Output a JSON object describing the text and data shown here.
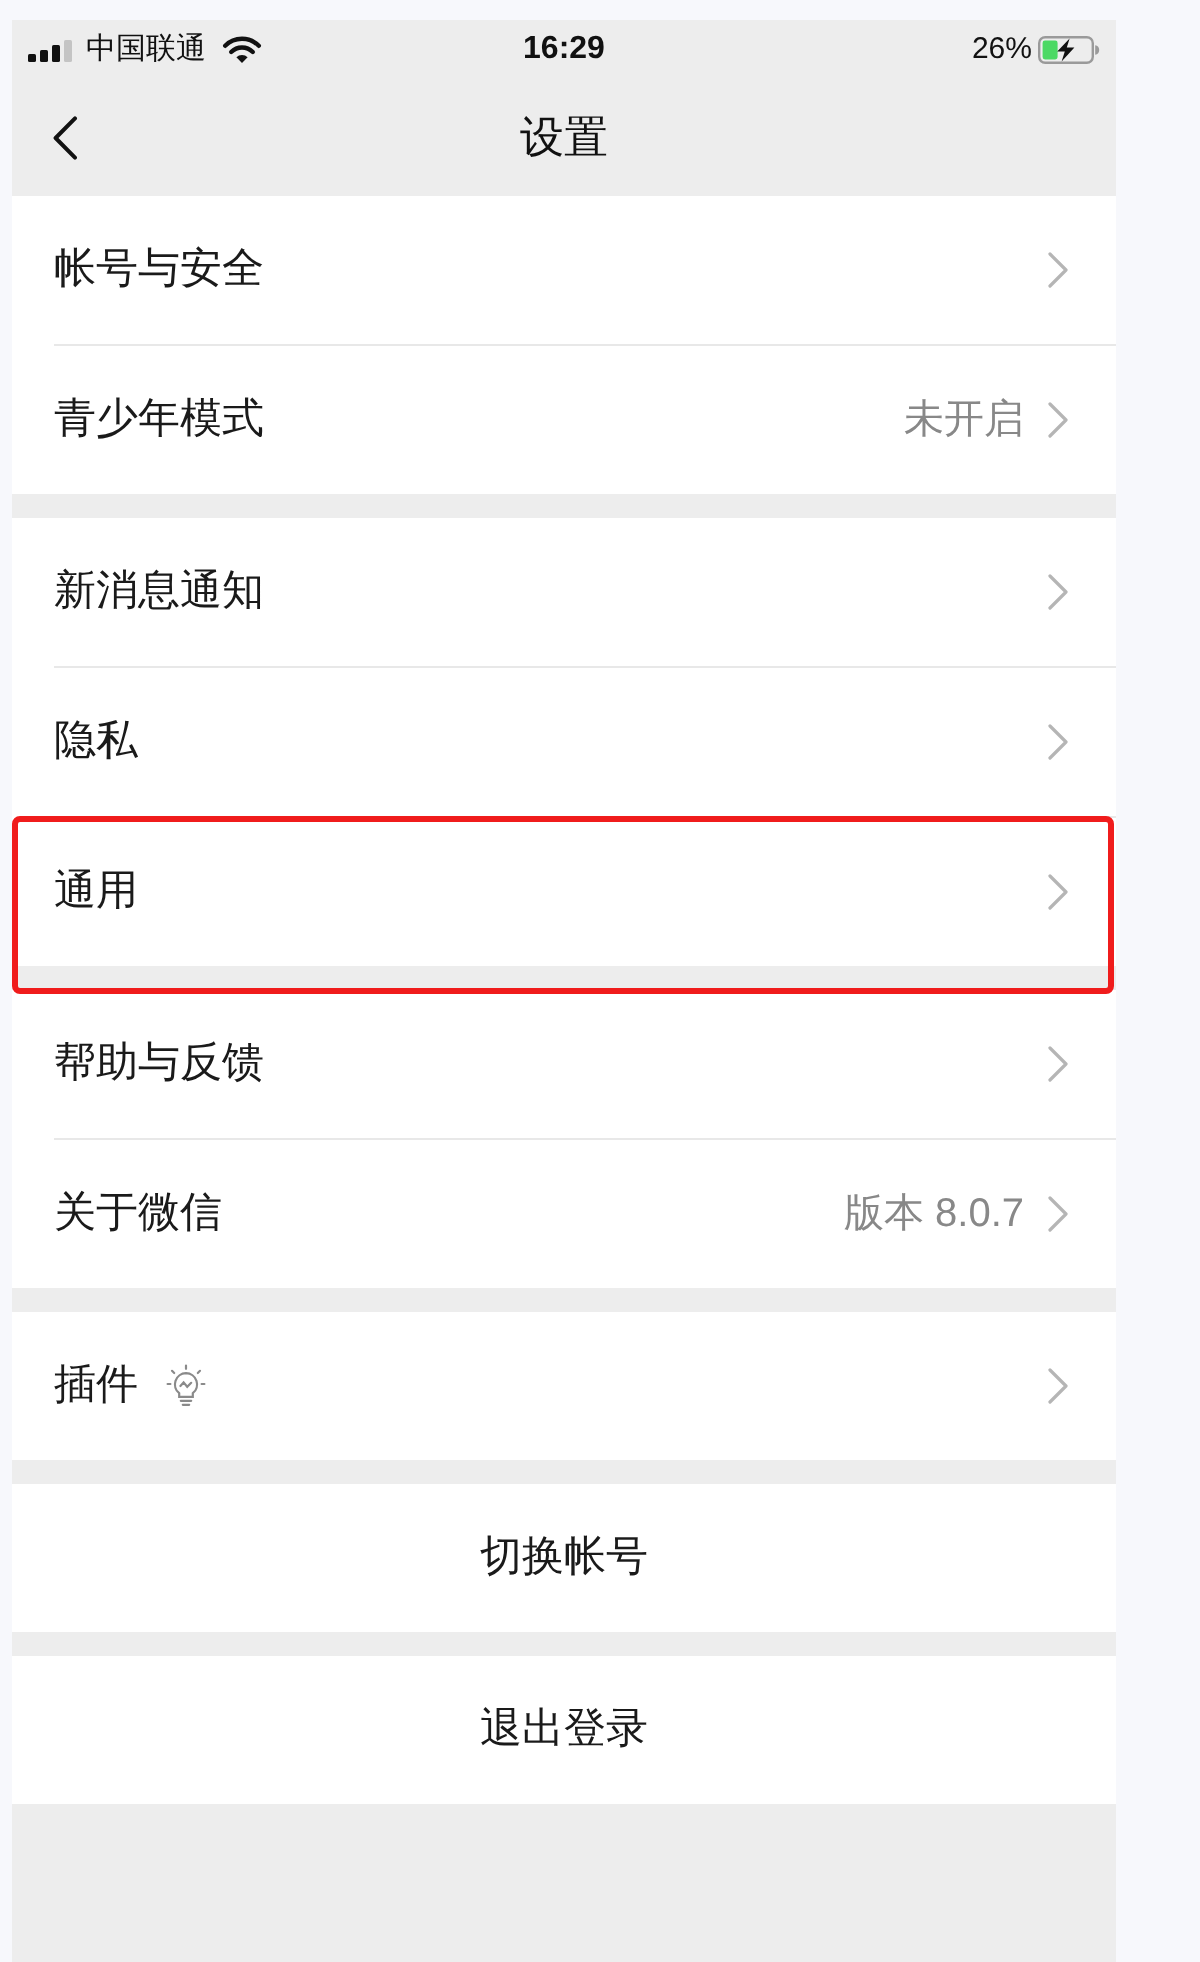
{
  "status_bar": {
    "carrier": "中国联通",
    "time": "16:29",
    "battery": "26%"
  },
  "nav_bar": {
    "title": "设置"
  },
  "groups": [
    {
      "items": [
        {
          "kind": "plain",
          "label": "帐号与安全",
          "highlighted": false
        },
        {
          "kind": "plain",
          "label": "青少年模式",
          "value": "未开启",
          "highlighted": false
        }
      ]
    },
    {
      "items": [
        {
          "kind": "plain",
          "label": "新消息通知",
          "highlighted": false
        },
        {
          "kind": "plain",
          "label": "隐私",
          "highlighted": false
        },
        {
          "kind": "plain",
          "label": "通用",
          "highlighted": true
        }
      ]
    },
    {
      "items": [
        {
          "kind": "plain",
          "label": "帮助与反馈",
          "highlighted": false
        },
        {
          "kind": "plain",
          "label": "关于微信",
          "value": "版本 8.0.7",
          "highlighted": false
        }
      ]
    },
    {
      "items": [
        {
          "kind": "with_icon",
          "label": "插件",
          "highlighted": false
        }
      ]
    }
  ],
  "actions": [
    {
      "label": "切换帐号"
    },
    {
      "label": "退出登录"
    }
  ]
}
